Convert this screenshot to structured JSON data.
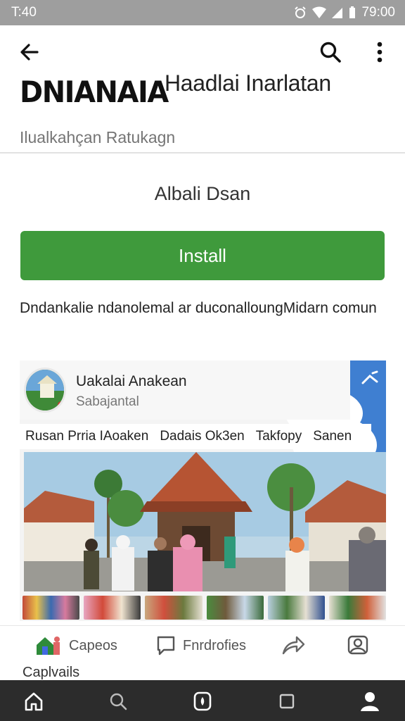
{
  "status_bar": {
    "time_left": "T:40",
    "time_right": "79:00"
  },
  "app": {
    "logo_text": "DNIANAIA",
    "title": "Haadlai Inarlatan",
    "subtitle": "Ilualkahçan  Ratukagn",
    "developer": "Albali Dsan",
    "install_label": "Install",
    "description": "Dndankalie ndanolemal ar duconalloungMidarn comun"
  },
  "card": {
    "title": "Uakalai Anakean",
    "subtitle": "Sabajantal",
    "captions": [
      "Rusan Prria IAoaken",
      "Dadais Ok3en",
      "Takfopy",
      "Sanen"
    ]
  },
  "actions": {
    "items": [
      {
        "label": "Capeos",
        "icon": "house-icon"
      },
      {
        "label": "Fnrdrofies",
        "icon": "chat-bubble-icon"
      },
      {
        "label": "",
        "icon": "share-icon"
      },
      {
        "label": "",
        "icon": "profile-icon"
      }
    ],
    "more_label": "Caplvails"
  },
  "colors": {
    "accent_green": "#3f9a3c",
    "status_bar": "#9e9e9e",
    "nav_bar": "#2c2c2c",
    "sky_blue": "#3f7fd1"
  }
}
